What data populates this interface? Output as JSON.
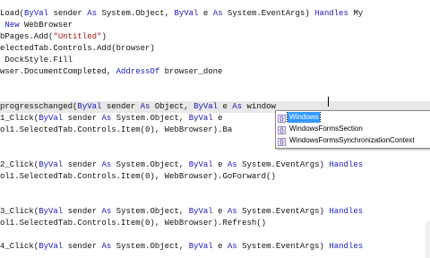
{
  "colors": {
    "keyword": "#1a1ab8",
    "string": "#a31515",
    "plain": "#111111",
    "selection": "#3399ff"
  },
  "lines": [
    {
      "current": false,
      "parts": [
        {
          "t": "Load(",
          "c": "plain"
        },
        {
          "t": "ByVal",
          "c": "kw"
        },
        {
          "t": " sender ",
          "c": "plain"
        },
        {
          "t": "As",
          "c": "kw"
        },
        {
          "t": " System.Object, ",
          "c": "plain"
        },
        {
          "t": "ByVal",
          "c": "kw"
        },
        {
          "t": " e ",
          "c": "plain"
        },
        {
          "t": "As",
          "c": "kw"
        },
        {
          "t": " System.EventArgs) ",
          "c": "plain"
        },
        {
          "t": "Handles",
          "c": "kw"
        },
        {
          "t": " My",
          "c": "plain"
        }
      ]
    },
    {
      "current": false,
      "parts": [
        {
          "t": " ",
          "c": "plain"
        },
        {
          "t": "New",
          "c": "kw"
        },
        {
          "t": " WebBrowser",
          "c": "plain"
        }
      ]
    },
    {
      "current": false,
      "parts": [
        {
          "t": "bPages.Add(",
          "c": "plain"
        },
        {
          "t": "\"Untitled\"",
          "c": "str"
        },
        {
          "t": ")",
          "c": "plain"
        }
      ]
    },
    {
      "current": false,
      "parts": [
        {
          "t": "electedTab.Controls.Add(browser)",
          "c": "plain"
        }
      ]
    },
    {
      "current": false,
      "parts": [
        {
          "t": " DockStyle.Fill",
          "c": "plain"
        }
      ]
    },
    {
      "current": false,
      "parts": [
        {
          "t": "wser.DocumentCompleted, ",
          "c": "plain"
        },
        {
          "t": "AddressOf",
          "c": "kw"
        },
        {
          "t": " browser_done",
          "c": "plain"
        }
      ]
    },
    {
      "current": false,
      "parts": []
    },
    {
      "current": false,
      "parts": []
    },
    {
      "current": true,
      "parts": [
        {
          "t": "progresschanged(",
          "c": "plain"
        },
        {
          "t": "ByVal",
          "c": "kw"
        },
        {
          "t": " sender ",
          "c": "plain"
        },
        {
          "t": "As",
          "c": "kw"
        },
        {
          "t": " Object, ",
          "c": "plain"
        },
        {
          "t": "ByVal",
          "c": "kw"
        },
        {
          "t": " e ",
          "c": "plain"
        },
        {
          "t": "As",
          "c": "kw"
        },
        {
          "t": " window",
          "c": "plain"
        }
      ]
    },
    {
      "current": false,
      "parts": [
        {
          "t": "1_Click(",
          "c": "plain"
        },
        {
          "t": "ByVal",
          "c": "kw"
        },
        {
          "t": " sender ",
          "c": "plain"
        },
        {
          "t": "As",
          "c": "kw"
        },
        {
          "t": " System.Object, ",
          "c": "plain"
        },
        {
          "t": "ByVal",
          "c": "kw"
        },
        {
          "t": " e",
          "c": "plain"
        }
      ]
    },
    {
      "current": false,
      "parts": [
        {
          "t": "ol1.SelectedTab.Controls.Item(0), WebBrowser).Ba",
          "c": "plain"
        }
      ]
    },
    {
      "current": false,
      "parts": []
    },
    {
      "current": false,
      "parts": []
    },
    {
      "current": false,
      "parts": [
        {
          "t": "2_Click(",
          "c": "plain"
        },
        {
          "t": "ByVal",
          "c": "kw"
        },
        {
          "t": " sender ",
          "c": "plain"
        },
        {
          "t": "As",
          "c": "kw"
        },
        {
          "t": " System.Object, ",
          "c": "plain"
        },
        {
          "t": "ByVal",
          "c": "kw"
        },
        {
          "t": " e ",
          "c": "plain"
        },
        {
          "t": "As",
          "c": "kw"
        },
        {
          "t": " System.EventArgs) ",
          "c": "plain"
        },
        {
          "t": "Handles",
          "c": "kw"
        }
      ]
    },
    {
      "current": false,
      "parts": [
        {
          "t": "ol1.SelectedTab.Controls.Item(0), WebBrowser).GoForward()",
          "c": "plain"
        }
      ]
    },
    {
      "current": false,
      "parts": []
    },
    {
      "current": false,
      "parts": []
    },
    {
      "current": false,
      "parts": [
        {
          "t": "3_Click(",
          "c": "plain"
        },
        {
          "t": "ByVal",
          "c": "kw"
        },
        {
          "t": " sender ",
          "c": "plain"
        },
        {
          "t": "As",
          "c": "kw"
        },
        {
          "t": " System.Object, ",
          "c": "plain"
        },
        {
          "t": "ByVal",
          "c": "kw"
        },
        {
          "t": " e ",
          "c": "plain"
        },
        {
          "t": "As",
          "c": "kw"
        },
        {
          "t": " System.EventArgs) ",
          "c": "plain"
        },
        {
          "t": "Handles",
          "c": "kw"
        }
      ]
    },
    {
      "current": false,
      "parts": [
        {
          "t": "ol1.SelectedTab.Controls.Item(0), WebBrowser).Refresh()",
          "c": "plain"
        }
      ]
    },
    {
      "current": false,
      "parts": []
    },
    {
      "current": false,
      "parts": [
        {
          "t": "4_Click(",
          "c": "plain"
        },
        {
          "t": "ByVal",
          "c": "kw"
        },
        {
          "t": " sender ",
          "c": "plain"
        },
        {
          "t": "As",
          "c": "kw"
        },
        {
          "t": " System.Object, ",
          "c": "plain"
        },
        {
          "t": "ByVal",
          "c": "kw"
        },
        {
          "t": " e ",
          "c": "plain"
        },
        {
          "t": "As",
          "c": "kw"
        },
        {
          "t": " System.EventArgs) ",
          "c": "plain"
        },
        {
          "t": "Handles",
          "c": "kw"
        }
      ]
    }
  ],
  "autocomplete": {
    "items": [
      {
        "icon": "namespace-icon",
        "glyph": "{}",
        "label": "Windows",
        "selected": true
      },
      {
        "icon": "namespace-icon",
        "glyph": "{}",
        "label": "WindowsFormsSection",
        "selected": false
      },
      {
        "icon": "namespace-icon",
        "glyph": "{}",
        "label": "WindowsFormsSynchronizationContext",
        "selected": false
      }
    ]
  }
}
